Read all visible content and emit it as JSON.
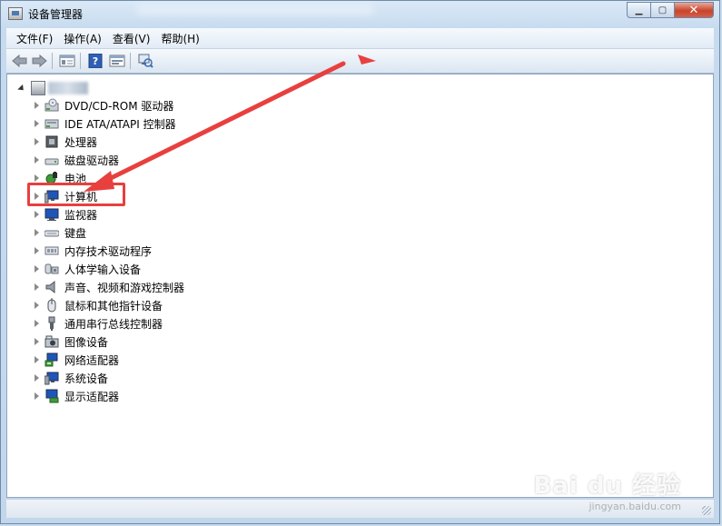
{
  "window": {
    "title": "设备管理器",
    "buttons": {
      "minimize": "▁",
      "maximize": "▢",
      "close": "✕"
    }
  },
  "menu": [
    {
      "label": "文件(F)"
    },
    {
      "label": "操作(A)"
    },
    {
      "label": "查看(V)"
    },
    {
      "label": "帮助(H)"
    }
  ],
  "toolbar": {
    "icons": [
      "back-icon",
      "forward-icon",
      "properties-icon",
      "help-icon",
      "view-icon",
      "scan-hardware-icon"
    ]
  },
  "tree": {
    "items": [
      {
        "label": "DVD/CD-ROM 驱动器",
        "icon": "dvd-icon"
      },
      {
        "label": "IDE ATA/ATAPI 控制器",
        "icon": "ide-controller-icon"
      },
      {
        "label": "处理器",
        "icon": "processor-icon"
      },
      {
        "label": "磁盘驱动器",
        "icon": "disk-drive-icon"
      },
      {
        "label": "电池",
        "icon": "battery-icon"
      },
      {
        "label": "计算机",
        "icon": "computer-icon"
      },
      {
        "label": "监视器",
        "icon": "monitor-icon"
      },
      {
        "label": "键盘",
        "icon": "keyboard-icon"
      },
      {
        "label": "内存技术驱动程序",
        "icon": "memory-icon"
      },
      {
        "label": "人体学输入设备",
        "icon": "hid-icon"
      },
      {
        "label": "声音、视频和游戏控制器",
        "icon": "sound-icon"
      },
      {
        "label": "鼠标和其他指针设备",
        "icon": "mouse-icon"
      },
      {
        "label": "通用串行总线控制器",
        "icon": "usb-icon"
      },
      {
        "label": "图像设备",
        "icon": "camera-icon"
      },
      {
        "label": "网络适配器",
        "icon": "network-icon"
      },
      {
        "label": "系统设备",
        "icon": "system-device-icon"
      },
      {
        "label": "显示适配器",
        "icon": "display-adapter-icon"
      }
    ]
  },
  "watermark": {
    "text": "Bai du 经验",
    "sub": "jingyan.baidu.com"
  },
  "colors": {
    "annotation": "#e8403e",
    "accent": "#4a7ab5"
  }
}
